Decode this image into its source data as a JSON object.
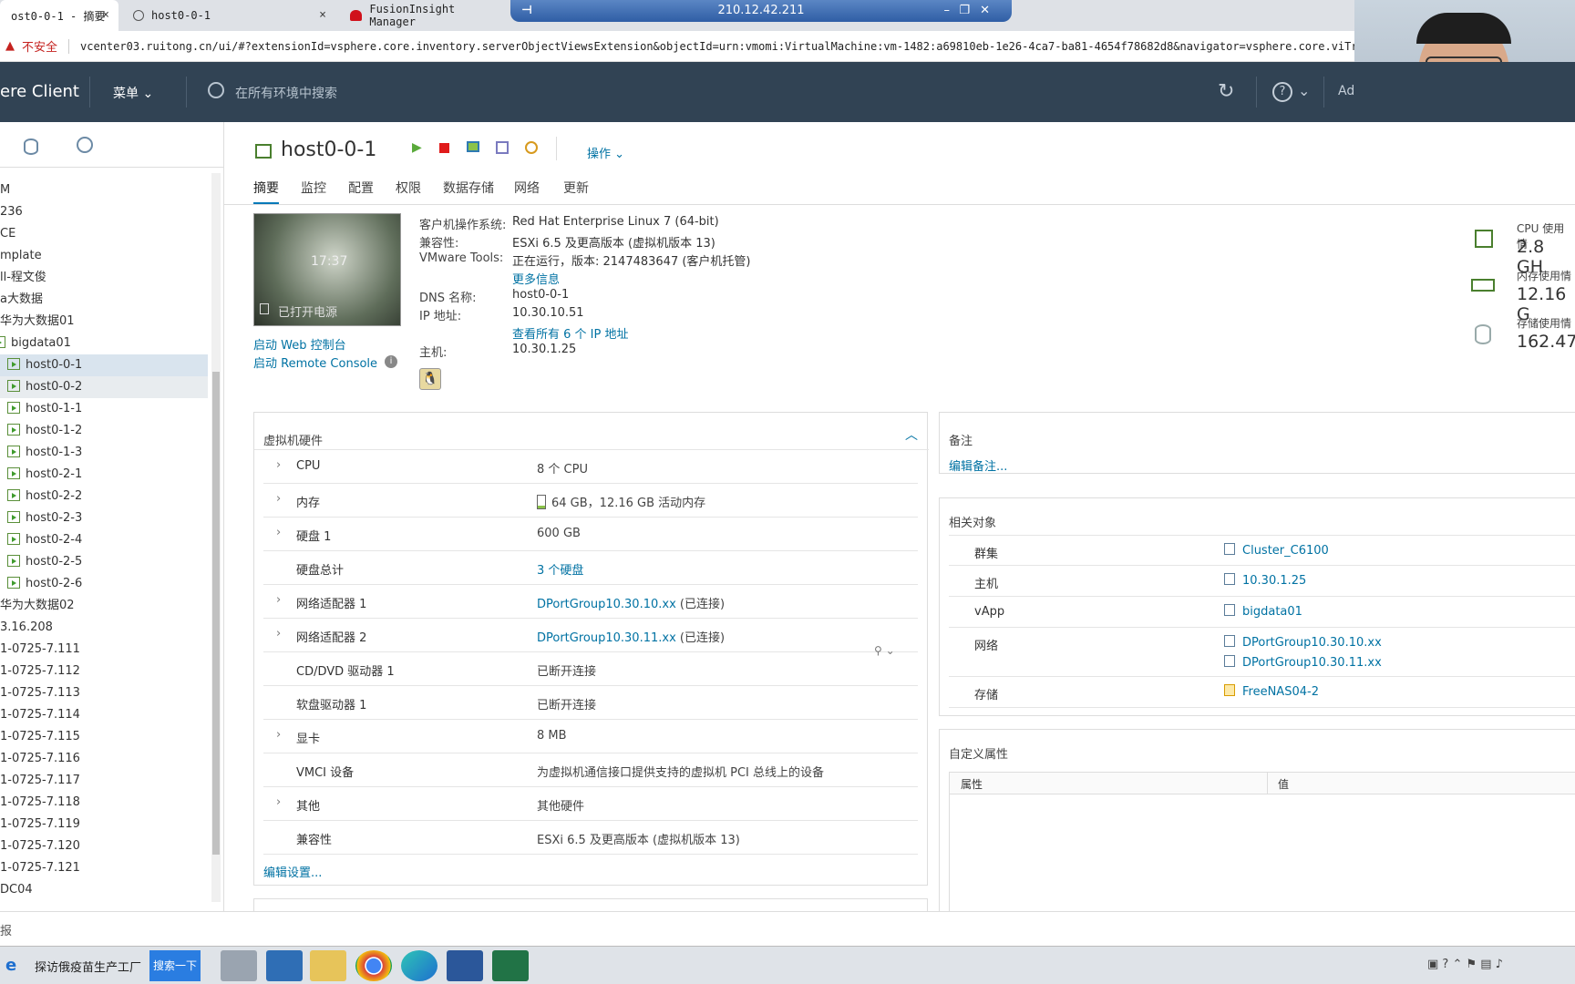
{
  "browser": {
    "tabs": [
      {
        "title": "ost0-0-1 - 摘要",
        "close": "×"
      },
      {
        "title": "host0-0-1",
        "close": "×"
      },
      {
        "title": "FusionInsight Manager",
        "close": ""
      }
    ],
    "rdp_ip": "210.12.42.211",
    "insecure": "不安全",
    "url": "vcenter03.ruitong.cn/ui/#?extensionId=vsphere.core.inventory.serverObjectViewsExtension&objectId=urn:vmomi:VirtualMachine:vm-1482:a69810eb-1e26-4ca7-ba81-4654f78682d8&navigator=vsphere.core.viTree.hos"
  },
  "header": {
    "app_title": "ere Client",
    "menu_label": "菜单",
    "search_placeholder": "在所有环境中搜索",
    "user_abbr": "Ad"
  },
  "navigator": {
    "items": [
      {
        "label": "M",
        "type": "text"
      },
      {
        "label": "236",
        "type": "text"
      },
      {
        "label": "CE",
        "type": "text"
      },
      {
        "label": "mplate",
        "type": "text"
      },
      {
        "label": "ll-程文俊",
        "type": "text"
      },
      {
        "label": "a大数据",
        "type": "text"
      },
      {
        "label": "华为大数据01",
        "type": "text"
      },
      {
        "label": "bigdata01",
        "type": "vapp"
      },
      {
        "label": "host0-0-1",
        "type": "vm"
      },
      {
        "label": "host0-0-2",
        "type": "vm"
      },
      {
        "label": "host0-1-1",
        "type": "vm"
      },
      {
        "label": "host0-1-2",
        "type": "vm"
      },
      {
        "label": "host0-1-3",
        "type": "vm"
      },
      {
        "label": "host0-2-1",
        "type": "vm"
      },
      {
        "label": "host0-2-2",
        "type": "vm"
      },
      {
        "label": "host0-2-3",
        "type": "vm"
      },
      {
        "label": "host0-2-4",
        "type": "vm"
      },
      {
        "label": "host0-2-5",
        "type": "vm"
      },
      {
        "label": "host0-2-6",
        "type": "vm"
      },
      {
        "label": "华为大数据02",
        "type": "text"
      },
      {
        "label": "3.16.208",
        "type": "text"
      },
      {
        "label": "1-0725-7.111",
        "type": "text"
      },
      {
        "label": "1-0725-7.112",
        "type": "text"
      },
      {
        "label": "1-0725-7.113",
        "type": "text"
      },
      {
        "label": "1-0725-7.114",
        "type": "text"
      },
      {
        "label": "1-0725-7.115",
        "type": "text"
      },
      {
        "label": "1-0725-7.116",
        "type": "text"
      },
      {
        "label": "1-0725-7.117",
        "type": "text"
      },
      {
        "label": "1-0725-7.118",
        "type": "text"
      },
      {
        "label": "1-0725-7.119",
        "type": "text"
      },
      {
        "label": "1-0725-7.120",
        "type": "text"
      },
      {
        "label": "1-0725-7.121",
        "type": "text"
      },
      {
        "label": "DC04",
        "type": "text"
      }
    ]
  },
  "vm": {
    "name": "host0-0-1",
    "actions_label": "操作",
    "tabs": [
      "摘要",
      "监控",
      "配置",
      "权限",
      "数据存储",
      "网络",
      "更新"
    ],
    "console_time": "17:37",
    "power_state": "已打开电源",
    "launch_web_console": "启动 Web 控制台",
    "launch_remote_console": "启动 Remote Console",
    "info": {
      "guest_os_label": "客户机操作系统:",
      "guest_os": "Red Hat Enterprise Linux 7 (64-bit)",
      "compat_label": "兼容性:",
      "compat": "ESXi 6.5 及更高版本 (虚拟机版本 13)",
      "tools_label": "VMware Tools:",
      "tools": "正在运行，版本: 2147483647 (客户机托管)",
      "more_info": "更多信息",
      "dns_label": "DNS 名称:",
      "dns": "host0-0-1",
      "ip_label": "IP 地址:",
      "ip": "10.30.10.51",
      "view_all_ips": "查看所有 6 个 IP 地址",
      "host_label": "主机:",
      "host": "10.30.1.25"
    },
    "usage": {
      "cpu_label": "CPU 使用情",
      "cpu_value": "2.8 GH",
      "mem_label": "内存使用情",
      "mem_value": "12.16 G",
      "storage_label": "存储使用情",
      "storage_value": "162.47"
    }
  },
  "hardware": {
    "title": "虚拟机硬件",
    "rows": [
      {
        "key": "CPU",
        "value": "8 个 CPU",
        "expandable": true,
        "link": false
      },
      {
        "key": "内存",
        "value": "64 GB，12.16 GB 活动内存",
        "expandable": true,
        "link": false
      },
      {
        "key": "硬盘 1",
        "value": "600 GB",
        "expandable": true,
        "link": false
      },
      {
        "key": "硬盘总计",
        "value": "3 个硬盘",
        "expandable": false,
        "link": true
      },
      {
        "key": "网络适配器 1",
        "value": "DPortGroup10.30.10.xx",
        "suffix": " (已连接)",
        "expandable": true,
        "link": true
      },
      {
        "key": "网络适配器 2",
        "value": "DPortGroup10.30.11.xx",
        "suffix": " (已连接)",
        "expandable": true,
        "link": true
      },
      {
        "key": "CD/DVD 驱动器 1",
        "value": "已断开连接",
        "expandable": false,
        "link": false
      },
      {
        "key": "软盘驱动器 1",
        "value": "已断开连接",
        "expandable": false,
        "link": false
      },
      {
        "key": "显卡",
        "value": "8 MB",
        "expandable": true,
        "link": false
      },
      {
        "key": "VMCI 设备",
        "value": "为虚拟机通信接口提供支持的虚拟机 PCI 总线上的设备",
        "expandable": false,
        "link": false
      },
      {
        "key": "其他",
        "value": "其他硬件",
        "expandable": true,
        "link": false
      },
      {
        "key": "兼容性",
        "value": "ESXi 6.5 及更高版本 (虚拟机版本 13)",
        "expandable": false,
        "link": false
      }
    ],
    "edit_settings": "编辑设置..."
  },
  "notes": {
    "title": "备注",
    "edit": "编辑备注..."
  },
  "related": {
    "title": "相关对象",
    "rows": [
      {
        "key": "群集",
        "values": [
          "Cluster_C6100"
        ]
      },
      {
        "key": "主机",
        "values": [
          "10.30.1.25"
        ]
      },
      {
        "key": "vApp",
        "values": [
          "bigdata01"
        ]
      },
      {
        "key": "网络",
        "values": [
          "DPortGroup10.30.10.xx",
          "DPortGroup10.30.11.xx"
        ]
      },
      {
        "key": "存储",
        "values": [
          "FreeNAS04-2"
        ]
      }
    ]
  },
  "custom_attrs": {
    "title": "自定义属性",
    "col_attr": "属性",
    "col_value": "值"
  },
  "status_bar": {
    "text": "报"
  },
  "taskbar": {
    "ie_search_text": "探访俄疫苗生产工厂",
    "search_button": "搜索一下"
  }
}
